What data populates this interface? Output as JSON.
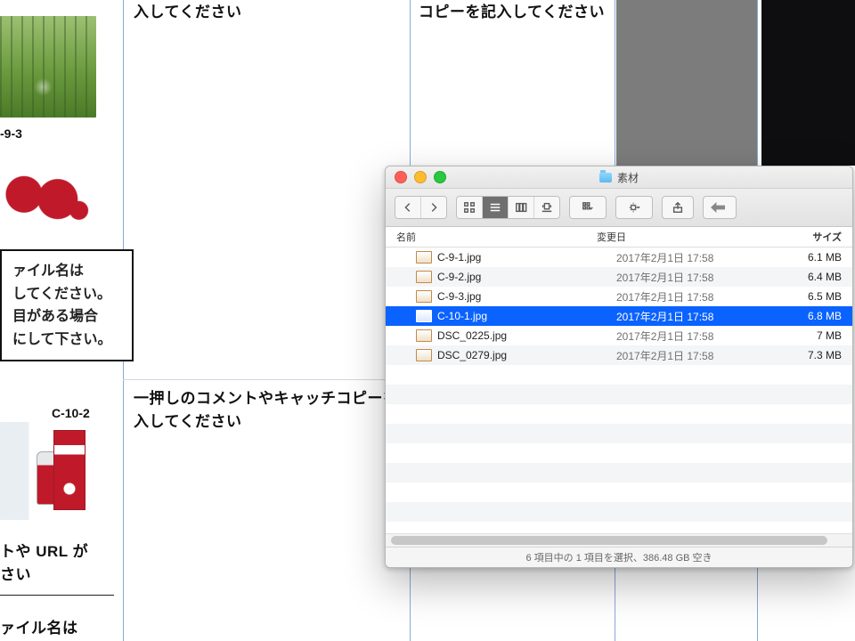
{
  "doc": {
    "row1_left_text": "入してください",
    "row1_right_text": "コピーを記入してください",
    "thumb1_label": "-9-3",
    "thumb2_label": "C-10-2",
    "textbox_lines": {
      "l1": "ァイル名は",
      "l2": "してください。",
      "l3": "目がある場合",
      "l4": "にして下さい。"
    },
    "row2_left_text_a": "一押しのコメントやキャッチコピーを",
    "row2_left_text_b": "入してください",
    "bottom_lines": {
      "b1": "トや URL が",
      "b2": "さい",
      "b3": "ァイル名は"
    }
  },
  "finder": {
    "title": "素材",
    "columns": {
      "name": "名前",
      "date": "変更日",
      "size": "サイズ"
    },
    "files": [
      {
        "name": "C-9-1.jpg",
        "date": "2017年2月1日 17:58",
        "size": "6.1 MB",
        "selected": false
      },
      {
        "name": "C-9-2.jpg",
        "date": "2017年2月1日 17:58",
        "size": "6.4 MB",
        "selected": false
      },
      {
        "name": "C-9-3.jpg",
        "date": "2017年2月1日 17:58",
        "size": "6.5 MB",
        "selected": false
      },
      {
        "name": "C-10-1.jpg",
        "date": "2017年2月1日 17:58",
        "size": "6.8 MB",
        "selected": true
      },
      {
        "name": "DSC_0225.jpg",
        "date": "2017年2月1日 17:58",
        "size": "7 MB",
        "selected": false
      },
      {
        "name": "DSC_0279.jpg",
        "date": "2017年2月1日 17:58",
        "size": "7.3 MB",
        "selected": false
      }
    ],
    "status": "6 項目中の 1 項目を選択、386.48 GB 空き"
  }
}
